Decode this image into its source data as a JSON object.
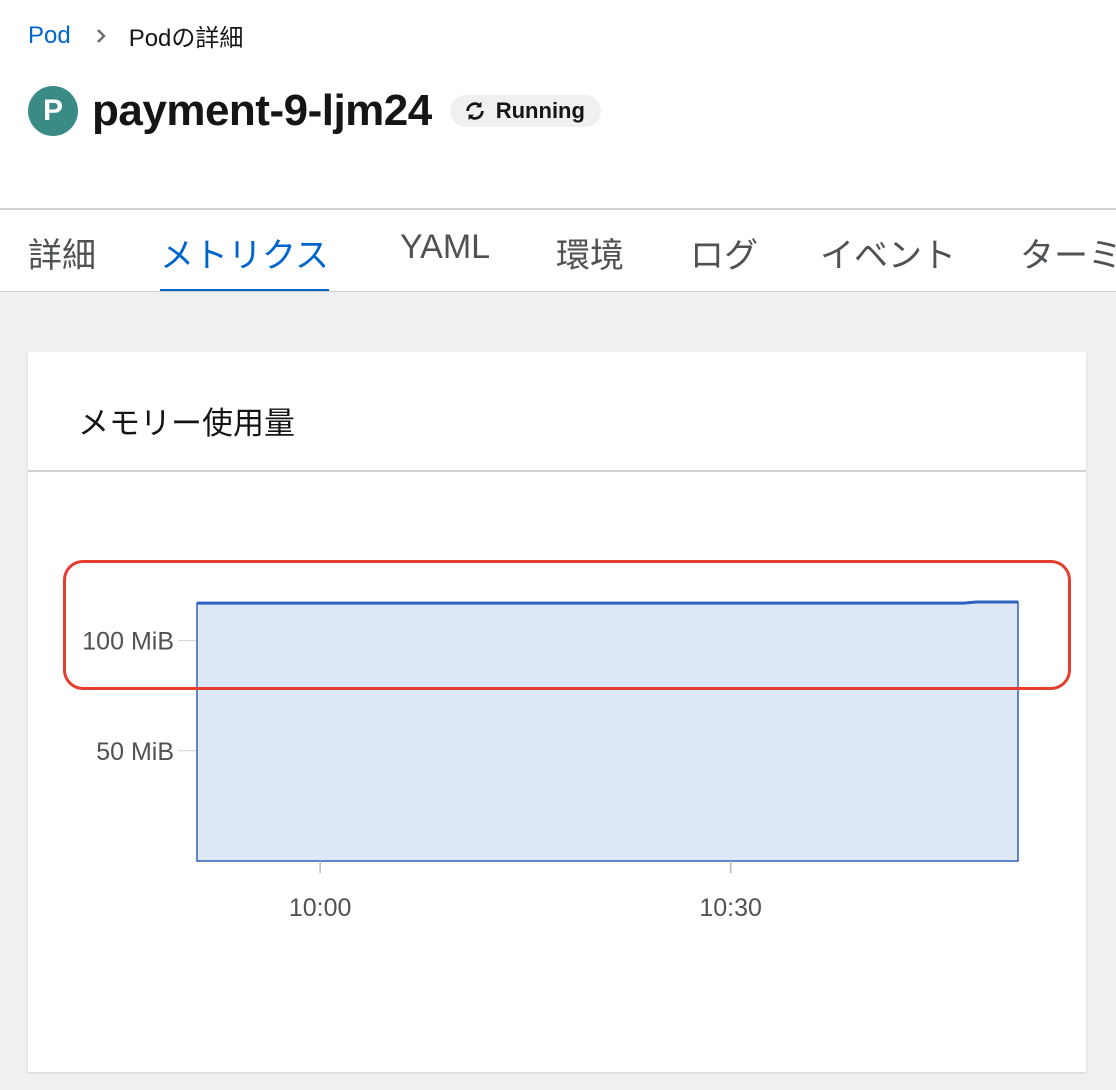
{
  "breadcrumb": {
    "parent": "Pod",
    "current": "Podの詳細"
  },
  "header": {
    "badge_letter": "P",
    "pod_name": "payment-9-ljm24",
    "status": "Running",
    "status_icon": "sync-icon"
  },
  "tabs": [
    {
      "label": "詳細",
      "active": false
    },
    {
      "label": "メトリクス",
      "active": true
    },
    {
      "label": "YAML",
      "active": false
    },
    {
      "label": "環境",
      "active": false
    },
    {
      "label": "ログ",
      "active": false
    },
    {
      "label": "イベント",
      "active": false
    },
    {
      "label": "ターミ",
      "active": false
    }
  ],
  "card": {
    "title": "メモリー使用量"
  },
  "colors": {
    "accent": "#0066cc",
    "area_fill": "#dfe8f6",
    "line": "#2f62be",
    "highlight": "#e53d2f",
    "badge": "#3a8a86"
  },
  "chart_data": {
    "type": "area",
    "title": "メモリー使用量",
    "x_ticks": [
      "10:00",
      "10:30"
    ],
    "y_ticks": [
      "50 MiB",
      "100 MiB"
    ],
    "unit": "MiB",
    "x_minutes": [
      -9,
      0,
      30,
      47,
      48,
      51
    ],
    "values": [
      117,
      117,
      117,
      117,
      117.5,
      117.5
    ],
    "x_range_minutes": [
      -9,
      51
    ],
    "y_range": [
      0,
      117.5
    ],
    "grid": true
  }
}
